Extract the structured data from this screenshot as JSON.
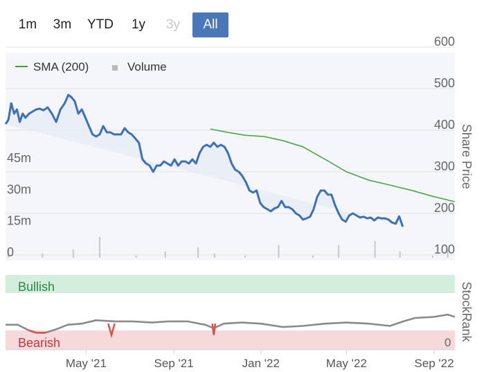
{
  "range_selector": {
    "buttons": [
      {
        "label": "1m",
        "state": "normal"
      },
      {
        "label": "3m",
        "state": "normal"
      },
      {
        "label": "YTD",
        "state": "normal"
      },
      {
        "label": "1y",
        "state": "normal"
      },
      {
        "label": "3y",
        "state": "disabled"
      },
      {
        "label": "All",
        "state": "active"
      }
    ]
  },
  "legend": {
    "sma_label": "SMA (200)",
    "volume_label": "Volume",
    "sma_color": "#3aa335",
    "volume_color": "#b9b9b9"
  },
  "colors": {
    "price": "#3b6fba",
    "sma": "#3aa335",
    "volume": "#c8c8c8",
    "rank": "#8a8a8a",
    "bearish_segment": "#d9534f",
    "bullish_band": "#d4eedd",
    "bearish_band": "#f6d9da",
    "chart_bg": "#f4f6fb"
  },
  "chart_data": [
    {
      "type": "line",
      "ylabel": "Share Price",
      "y_ticks": [
        "600",
        "500",
        "400",
        "300",
        "200",
        "100"
      ],
      "ylim": [
        100,
        600
      ],
      "volume_ticks": [
        "45m",
        "30m",
        "15m",
        "0"
      ],
      "x_ticks": [
        "May '21",
        "Sep '21",
        "Jan '22",
        "May '22",
        "Sep '22"
      ],
      "x_domain": [
        "2021-01-08",
        "2022-09-30"
      ],
      "price_series": {
        "name": "Price",
        "x": [
          "2021-01-08",
          "2021-01-12",
          "2021-01-16",
          "2021-01-20",
          "2021-01-24",
          "2021-01-28",
          "2021-02-01",
          "2021-02-05",
          "2021-02-10",
          "2021-02-15",
          "2021-02-20",
          "2021-02-25",
          "2021-03-02",
          "2021-03-08",
          "2021-03-14",
          "2021-03-20",
          "2021-03-26",
          "2021-04-01",
          "2021-04-06",
          "2021-04-10",
          "2021-04-15",
          "2021-04-20",
          "2021-04-25",
          "2021-04-30",
          "2021-05-05",
          "2021-05-10",
          "2021-05-15",
          "2021-05-20",
          "2021-05-25",
          "2021-05-30",
          "2021-06-04",
          "2021-06-09",
          "2021-06-14",
          "2021-06-19",
          "2021-06-24",
          "2021-06-29",
          "2021-07-04",
          "2021-07-09",
          "2021-07-14",
          "2021-07-19",
          "2021-07-24",
          "2021-07-29",
          "2021-08-03",
          "2021-08-08",
          "2021-08-13",
          "2021-08-18",
          "2021-08-23",
          "2021-08-28",
          "2021-09-02",
          "2021-09-07",
          "2021-09-12",
          "2021-09-17",
          "2021-09-22",
          "2021-09-27",
          "2021-10-02",
          "2021-10-07",
          "2021-10-12",
          "2021-10-17",
          "2021-10-22",
          "2021-10-27",
          "2021-11-01",
          "2021-11-06",
          "2021-11-11",
          "2021-11-16",
          "2021-11-21",
          "2021-11-26",
          "2021-12-01",
          "2021-12-06",
          "2021-12-11",
          "2021-12-16",
          "2021-12-21",
          "2021-12-26",
          "2021-12-31",
          "2022-01-05",
          "2022-01-10",
          "2022-01-15",
          "2022-01-20",
          "2022-01-25",
          "2022-01-30",
          "2022-02-04",
          "2022-02-09",
          "2022-02-14",
          "2022-02-19",
          "2022-02-24",
          "2022-03-01",
          "2022-03-06",
          "2022-03-11",
          "2022-03-16",
          "2022-03-21",
          "2022-03-26",
          "2022-03-31",
          "2022-04-05",
          "2022-04-10",
          "2022-04-15",
          "2022-04-20",
          "2022-04-25",
          "2022-04-30",
          "2022-05-05",
          "2022-05-10",
          "2022-05-15",
          "2022-05-20",
          "2022-05-25",
          "2022-05-30",
          "2022-06-04",
          "2022-06-09",
          "2022-06-14",
          "2022-06-19",
          "2022-06-24",
          "2022-06-29",
          "2022-07-04",
          "2022-07-09",
          "2022-07-14",
          "2022-07-19",
          "2022-07-24",
          "2022-07-29",
          "2022-08-03",
          "2022-08-08",
          "2022-08-13",
          "2022-08-18",
          "2022-08-23",
          "2022-08-28",
          "2022-09-02",
          "2022-09-07",
          "2022-09-12",
          "2022-09-17",
          "2022-09-22",
          "2022-09-27",
          "2022-09-30"
        ],
        "y": [
          415,
          425,
          465,
          440,
          450,
          420,
          440,
          430,
          440,
          445,
          450,
          452,
          448,
          455,
          440,
          420,
          450,
          465,
          485,
          480,
          470,
          440,
          450,
          430,
          410,
          390,
          385,
          390,
          410,
          395,
          395,
          390,
          390,
          390,
          405,
          395,
          390,
          380,
          370,
          330,
          320,
          315,
          300,
          315,
          315,
          325,
          320,
          315,
          330,
          315,
          325,
          325,
          320,
          330,
          320,
          345,
          360,
          365,
          360,
          370,
          360,
          365,
          360,
          345,
          320,
          305,
          300,
          290,
          275,
          255,
          250,
          255,
          225,
          215,
          210,
          205,
          212,
          215,
          230,
          215,
          215,
          210,
          200,
          195,
          185,
          188,
          192,
          210,
          240,
          255,
          255,
          245,
          245,
          220,
          200,
          185,
          180,
          195,
          200,
          195,
          190,
          192,
          188,
          190,
          183,
          190,
          188,
          188,
          185,
          178,
          175,
          193,
          168
        ]
      },
      "sma_series": {
        "name": "SMA (200)",
        "x": [
          "2021-10-22",
          "2021-11-15",
          "2021-12-10",
          "2022-01-05",
          "2022-02-01",
          "2022-03-01",
          "2022-04-01",
          "2022-05-01",
          "2022-06-01",
          "2022-07-01",
          "2022-08-01",
          "2022-09-01",
          "2022-09-30"
        ],
        "y": [
          403,
          395,
          388,
          385,
          375,
          360,
          330,
          300,
          280,
          268,
          255,
          240,
          228
        ]
      },
      "volume_series": {
        "name": "Volume",
        "x": [
          "2021-01-12",
          "2021-03-01",
          "2021-04-13",
          "2021-05-20",
          "2021-07-10",
          "2021-08-20",
          "2021-10-05",
          "2021-10-28",
          "2021-12-10",
          "2022-01-26",
          "2022-03-15",
          "2022-04-20",
          "2022-06-10",
          "2022-07-15",
          "2022-08-30",
          "2022-09-20"
        ],
        "y": [
          4,
          2,
          4,
          10,
          1,
          3,
          5,
          2,
          1,
          6,
          1,
          6,
          8,
          3,
          1,
          4
        ]
      }
    },
    {
      "type": "line",
      "ylabel": "StockRank",
      "band_labels": [
        "Bullish",
        "Bearish"
      ],
      "y_ticks": [
        "0"
      ],
      "ylim": [
        0,
        100
      ],
      "x_domain": [
        "2021-01-08",
        "2022-09-30"
      ],
      "series": [
        {
          "name": "StockRank",
          "x": [
            "2021-01-08",
            "2021-01-25",
            "2021-02-10",
            "2021-02-20",
            "2021-03-05",
            "2021-03-20",
            "2021-04-05",
            "2021-04-25",
            "2021-05-15",
            "2021-06-10",
            "2021-07-05",
            "2021-08-01",
            "2021-08-25",
            "2021-09-20",
            "2021-10-15",
            "2021-10-27",
            "2021-11-10",
            "2021-12-05",
            "2022-01-01",
            "2022-02-01",
            "2022-03-01",
            "2022-04-01",
            "2022-05-01",
            "2022-06-01",
            "2022-07-01",
            "2022-07-20",
            "2022-08-05",
            "2022-09-01",
            "2022-09-20",
            "2022-09-30"
          ],
          "y": [
            38,
            38,
            28,
            24,
            24,
            30,
            38,
            40,
            46,
            44,
            44,
            42,
            44,
            44,
            38,
            32,
            40,
            42,
            40,
            34,
            36,
            40,
            42,
            40,
            36,
            44,
            50,
            52,
            56,
            52
          ]
        }
      ],
      "bearish_intervals": [
        [
          "2021-02-06",
          "2021-03-05"
        ],
        [
          "2021-06-01",
          "2021-06-10"
        ],
        [
          "2021-10-25",
          "2021-10-29"
        ]
      ]
    }
  ]
}
